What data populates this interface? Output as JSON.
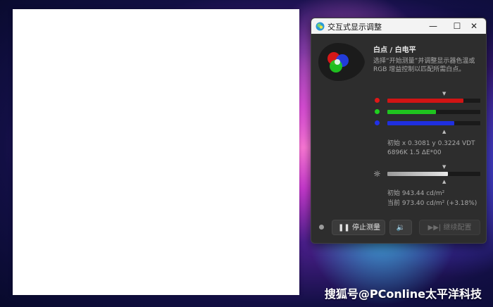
{
  "dialog": {
    "title": "交互式显示调整",
    "heading": "白点 / 白电平",
    "description": "选择“开始测量”并调整显示器色温或\nRGB 增益控制以匹配所需白点。",
    "rgb": {
      "red": {
        "value": 0.82,
        "color": "#d11414"
      },
      "green": {
        "value": 0.52,
        "color": "#1fc41f"
      },
      "blue": {
        "value": 0.72,
        "color": "#1f2fe0"
      }
    },
    "rgb_readout": {
      "line1": "初始 x 0.3081 y 0.3224 VDT",
      "line2": "6896K 1.5 ΔE*00"
    },
    "brightness": {
      "value": 0.65,
      "color": "#e8e8e8"
    },
    "brightness_readout": {
      "line1": "初始 943.44 cd/m²",
      "line2": "当前 973.40 cd/m² (+3.18%)"
    },
    "buttons": {
      "stop": "停止测量",
      "next": "继续配置"
    },
    "icons": {
      "app": "colorimeter-app-icon",
      "minimize": "minimize-icon",
      "maximize": "maximize-icon",
      "close": "close-icon",
      "brightness": "sun-icon",
      "pause": "pause-icon",
      "sound": "speaker-icon",
      "skip": "skip-forward-icon"
    }
  },
  "watermark": "搜狐号@PConline太平洋科技"
}
